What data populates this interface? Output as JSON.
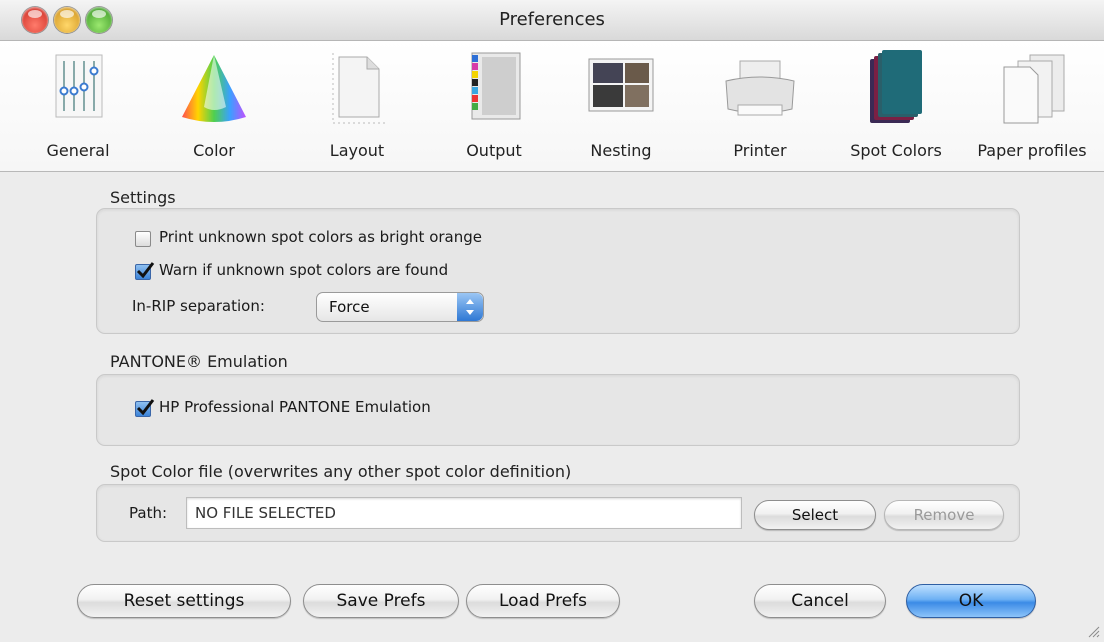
{
  "window": {
    "title": "Preferences"
  },
  "toolbar": {
    "items": [
      {
        "label": "General",
        "icon": "sliders-icon"
      },
      {
        "label": "Color",
        "icon": "color-cone-icon"
      },
      {
        "label": "Layout",
        "icon": "page-icon"
      },
      {
        "label": "Output",
        "icon": "output-sheet-icon"
      },
      {
        "label": "Nesting",
        "icon": "nesting-icon"
      },
      {
        "label": "Printer",
        "icon": "printer-icon"
      },
      {
        "label": "Spot Colors",
        "icon": "spot-colors-icon",
        "selected": true
      },
      {
        "label": "Paper profiles",
        "icon": "paper-stack-icon"
      }
    ]
  },
  "settings": {
    "title": "Settings",
    "print_unknown_label": "Print unknown spot colors as bright orange",
    "print_unknown_checked": false,
    "warn_label": "Warn if unknown spot colors are found",
    "warn_checked": true,
    "separation_label": "In-RIP separation:",
    "separation_value": "Force"
  },
  "pantone": {
    "title": "PANTONE® Emulation",
    "hp_label": "HP Professional PANTONE Emulation",
    "hp_checked": true
  },
  "spot_file": {
    "title": "Spot Color file (overwrites any other spot color definition)",
    "path_label": "Path:",
    "path_value": "NO FILE SELECTED",
    "select_label": "Select",
    "remove_label": "Remove"
  },
  "footer": {
    "reset_label": "Reset settings",
    "save_label": "Save Prefs",
    "load_label": "Load Prefs",
    "cancel_label": "Cancel",
    "ok_label": "OK"
  },
  "colors": {
    "accent": "#3b8be6",
    "window_bg": "#ececec"
  }
}
